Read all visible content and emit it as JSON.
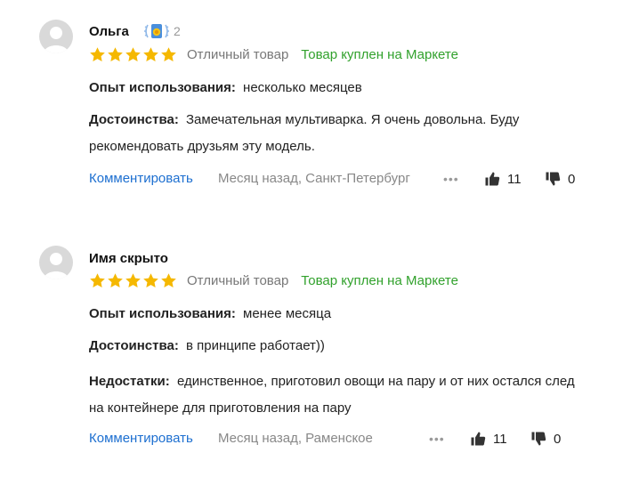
{
  "reviews": [
    {
      "author": "Ольга",
      "badge_icon": "achievement-badge-icon",
      "badge_count": "2",
      "rating": 5,
      "rating_text": "Отличный товар",
      "bought_label": "Товар куплен на Маркете",
      "experience_label": "Опыт использования:",
      "experience_value": "несколько месяцев",
      "pros_label": "Достоинства:",
      "pros_value": "Замечательная мультиварка. Я очень довольна. Буду рекомендовать друзьям эту модель.",
      "comment_label": "Комментировать",
      "meta": "Месяц назад, Санкт-Петербург",
      "likes": "11",
      "dislikes": "0"
    },
    {
      "author": "Имя скрыто",
      "rating": 5,
      "rating_text": "Отличный товар",
      "bought_label": "Товар куплен на Маркете",
      "experience_label": "Опыт использования:",
      "experience_value": "менее месяца",
      "pros_label": "Достоинства:",
      "pros_value": "в принципе работает))",
      "cons_label": "Недостатки:",
      "cons_value": "единственное, приготовил овощи на пару и от них остался след на контейнере для приготовления на пару",
      "comment_label": "Комментировать",
      "meta": "Месяц назад, Раменское",
      "likes": "11",
      "dislikes": "0"
    }
  ],
  "colors": {
    "star": "#f5b800",
    "bought": "#31a12c",
    "link": "#1d6fd0",
    "muted": "#888888"
  }
}
